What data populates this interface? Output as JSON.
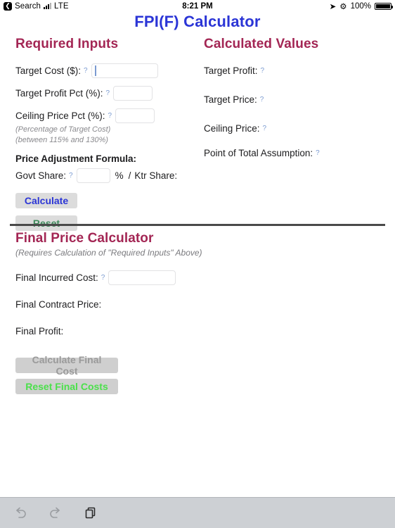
{
  "statusbar": {
    "back_icon": "back-chevron-icon",
    "back_label": "Search",
    "signal_icon": "cellular-signal-icon",
    "carrier": "LTE",
    "time": "8:21 PM",
    "location_icon": "location-arrow-icon",
    "bluetooth_icon": "bluetooth-icon",
    "battery_pct": "100%",
    "battery_icon": "battery-full-icon"
  },
  "app": {
    "title": "FPI(F) Calculator",
    "title_color": "#2B35D6",
    "heading_color": "#A32654"
  },
  "required_inputs": {
    "heading": "Required Inputs",
    "fields": [
      {
        "label": "Target Cost ($):",
        "help": "?",
        "value": ""
      },
      {
        "label": "Target Profit Pct (%):",
        "help": "?",
        "value": ""
      },
      {
        "label": "Ceiling Price Pct (%):",
        "help": "?",
        "value": ""
      }
    ],
    "ceiling_notes": [
      "(Percentage of Target Cost)",
      "(between 115% and 130%)"
    ],
    "formula": {
      "title": "Price Adjustment Formula:",
      "govt_label": "Govt Share:",
      "govt_help": "?",
      "govt_value": "",
      "percent_sign": "%",
      "separator": "/",
      "ktr_label": "Ktr Share:"
    },
    "calculate_label": "Calculate",
    "reset_label": "Reset",
    "calculate_color": "#2B35D6",
    "reset_color": "#3F8B5C"
  },
  "calculated_values": {
    "heading": "Calculated Values",
    "rows": [
      {
        "label": "Target Profit:",
        "help": "?",
        "value": ""
      },
      {
        "label": "Target Price:",
        "help": "?",
        "value": ""
      },
      {
        "label": "Ceiling Price:",
        "help": "?",
        "value": ""
      },
      {
        "label": "Point of Total Assumption:",
        "help": "?",
        "value": ""
      }
    ]
  },
  "final_price": {
    "heading": "Final Price Calculator",
    "subtitle": "(Requires Calculation of \"Required Inputs\" Above)",
    "incurred_cost_label": "Final Incurred Cost:",
    "incurred_cost_help": "?",
    "incurred_cost_value": "",
    "contract_price_label": "Final Contract Price:",
    "contract_price_value": "",
    "profit_label": "Final Profit:",
    "profit_value": "",
    "calculate_label": "Calculate Final Cost",
    "reset_label": "Reset Final Costs",
    "calculate_color": "#9a9a9a",
    "reset_color": "#4BE04B"
  },
  "toolbar": {
    "undo_icon": "undo-icon",
    "redo_icon": "redo-icon",
    "copy_icon": "copy-paste-icon"
  }
}
